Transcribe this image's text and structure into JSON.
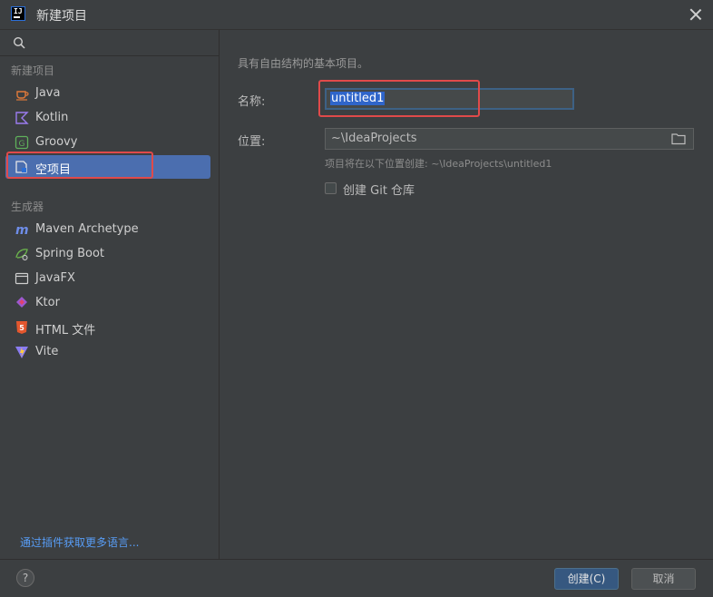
{
  "window": {
    "title": "新建项目"
  },
  "search": {
    "placeholder": ""
  },
  "sidebar": {
    "group_new_project": "新建项目",
    "group_generators": "生成器",
    "items": [
      {
        "label": "Java",
        "icon": "java-icon"
      },
      {
        "label": "Kotlin",
        "icon": "kotlin-icon"
      },
      {
        "label": "Groovy",
        "icon": "groovy-icon"
      },
      {
        "label": "空项目",
        "icon": "empty-project-icon",
        "selected": true
      }
    ],
    "generators": [
      {
        "label": "Maven Archetype",
        "icon": "maven-icon"
      },
      {
        "label": "Spring Boot",
        "icon": "spring-boot-icon"
      },
      {
        "label": "JavaFX",
        "icon": "javafx-icon"
      },
      {
        "label": "Ktor",
        "icon": "ktor-icon"
      },
      {
        "label": "HTML 文件",
        "icon": "html5-icon"
      },
      {
        "label": "Vite",
        "icon": "vite-icon"
      }
    ],
    "plugin_link": "通过插件获取更多语言..."
  },
  "main": {
    "description": "具有自由结构的基本项目。",
    "name_label": "名称:",
    "name_value": "untitled1",
    "location_label": "位置:",
    "location_value": "~\\IdeaProjects",
    "location_hint": "项目将在以下位置创建: ~\\IdeaProjects\\untitled1",
    "git_label": "创建 Git 仓库",
    "git_checked": false
  },
  "footer": {
    "help_label": "?",
    "create_label": "创建(C)",
    "cancel_label": "取消"
  },
  "colors": {
    "background": "#3c3f41",
    "selection": "#4b6eaf",
    "highlight_box": "#e04a4a",
    "link": "#589df6"
  }
}
